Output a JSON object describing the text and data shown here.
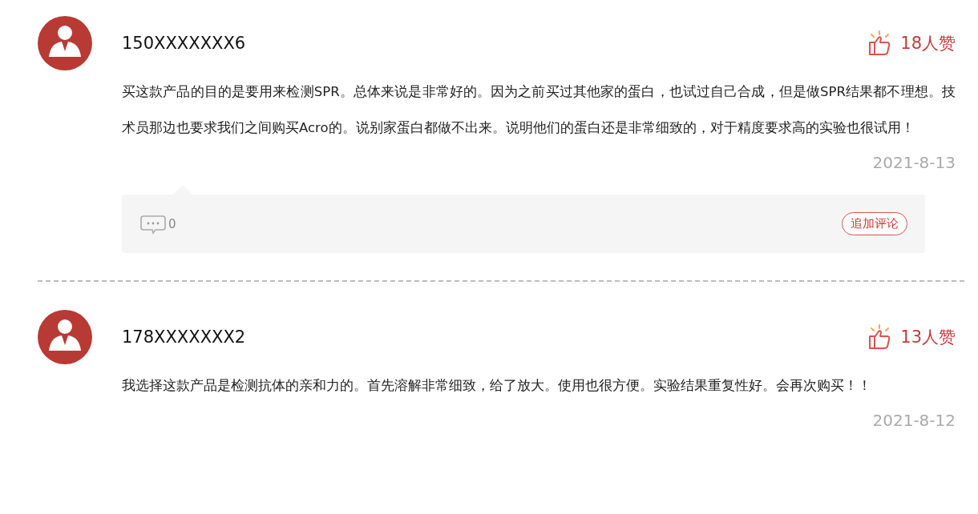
{
  "reviews": [
    {
      "user": "150XXXXXXX6",
      "likes": "18人赞",
      "text": "买这款产品的目的是要用来检测SPR。总体来说是非常好的。因为之前买过其他家的蛋白，也试过自己合成，但是做SPR结果都不理想。技术员那边也要求我们之间购买Acro的。说别家蛋白都做不出来。说明他们的蛋白还是非常细致的，对于精度要求高的实验也很试用！",
      "date": "2021-8-13",
      "comment_panel": {
        "count": "0",
        "button": "追加评论"
      }
    },
    {
      "user": "178XXXXXXX2",
      "likes": "13人赞",
      "text": "我选择这款产品是检测抗体的亲和力的。首先溶解非常细致，给了放大。使用也很方便。实验结果重复性好。会再次购买！！",
      "date": "2021-8-12"
    }
  ]
}
